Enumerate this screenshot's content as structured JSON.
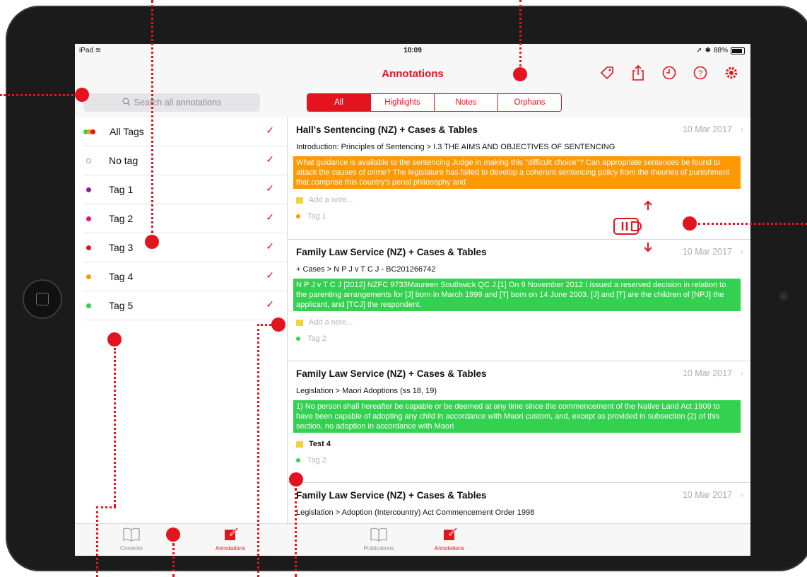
{
  "status": {
    "carrier": "iPad",
    "time": "10:09",
    "battery": "88%"
  },
  "nav": {
    "title": "Annotations",
    "icons": [
      "tag-icon",
      "share-icon",
      "history-icon",
      "help-icon",
      "settings-icon"
    ]
  },
  "search": {
    "placeholder": "Search all annotations"
  },
  "segments": [
    "All",
    "Highlights",
    "Notes",
    "Orphans"
  ],
  "tags": [
    {
      "label": "All Tags",
      "color": "multi"
    },
    {
      "label": "No tag",
      "color": "none"
    },
    {
      "label": "Tag 1",
      "color": "#8e1c9e"
    },
    {
      "label": "Tag 2",
      "color": "#e5157b"
    },
    {
      "label": "Tag 3",
      "color": "#e4141e"
    },
    {
      "label": "Tag 4",
      "color": "#ff9900"
    },
    {
      "label": "Tag 5",
      "color": "#33d14f"
    }
  ],
  "annotations": [
    {
      "title": "Hall's Sentencing (NZ) + Cases & Tables",
      "date": "10 Mar 2017",
      "path": "Introduction: Principles of Sentencing > I.3 THE AIMS AND OBJECTIVES OF SENTENCING",
      "highlight": "What guidance is available to the sentencing Judge in making this \"difficult choice\"? Can appropriate sentences be found to attack the causes of crime? The legislature has failed to develop a coherent sentencing policy from the theories of punishment that comprise this country's penal philosophy and",
      "highlight_color": "orange",
      "note": "Add a note...",
      "tag": "Tag 1"
    },
    {
      "title": "Family Law Service (NZ) + Cases & Tables",
      "date": "10 Mar 2017",
      "path": "+ Cases > N P J v T C J - BC201266742",
      "highlight": "N P J v T C J [2012] NZFC 9733Maureen Southwick QC J.[1] On 9 November 2012 I issued a reserved decision in relation to the parenting arrangements for [J] born in March 1999 and [T] born on 14 June 2003. [J] and [T] are the children of [NPJ] the applicant, and [TCJ] the respondent.",
      "highlight_color": "green",
      "note": "Add a note...",
      "tag": "Tag 2"
    },
    {
      "title": "Family Law Service (NZ) + Cases & Tables",
      "date": "10 Mar 2017",
      "path": "Legislation > Maori Adoptions (ss 18, 19)",
      "highlight": "1) No person shall hereafter be capable or be deemed at any time since the commencement of the Native Land Act 1909 to have been capable of adopting any child in accordance with Maori custom, and, except as provided in subsection (2) of this section, no adoption in accordance with Maori",
      "highlight_color": "green",
      "note": "Test 4",
      "tag": "Tag 2"
    },
    {
      "title": "Family Law Service (NZ) + Cases & Tables",
      "date": "10 Mar 2017",
      "path": "Legislation > Adoption (Intercountry) Act Commencement Order 1998"
    }
  ],
  "tabs": [
    {
      "label": "Contents",
      "active": false
    },
    {
      "label": "Annotations",
      "active": true
    },
    {
      "label": "Publications",
      "active": false
    },
    {
      "label": "Annotations",
      "active": true
    }
  ],
  "colors": {
    "accent": "#e4141e",
    "orange_highlight": "#ff9900",
    "green_highlight": "#33d14f"
  }
}
